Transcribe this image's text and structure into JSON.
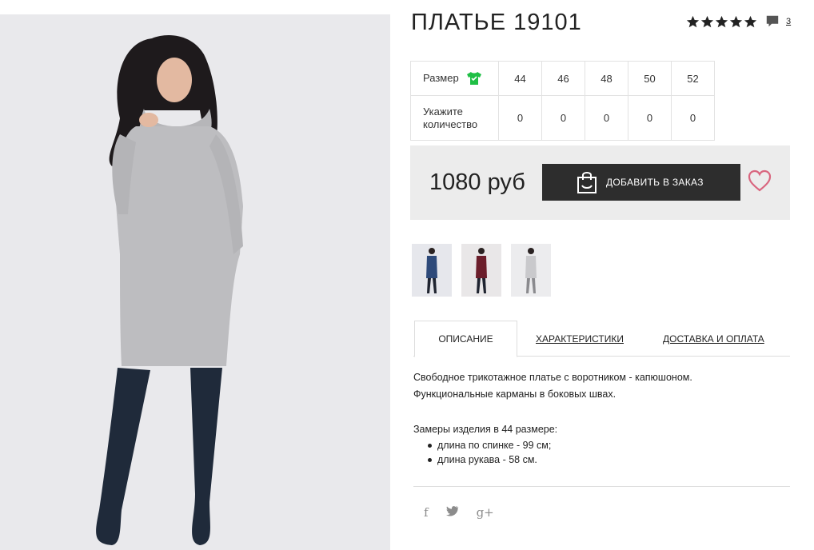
{
  "product": {
    "title": "ПЛАТЬЕ 19101",
    "rating_stars": 5,
    "review_count": "3",
    "price": "1080 руб",
    "add_to_order_label": "ДОБАВИТЬ В ЗАКАЗ"
  },
  "size_table": {
    "size_label": "Размер",
    "qty_label": "Укажите количество",
    "sizes": [
      "44",
      "46",
      "48",
      "50",
      "52"
    ],
    "quantities": [
      "0",
      "0",
      "0",
      "0",
      "0"
    ]
  },
  "thumbnails": [
    {
      "color": "#2e4a7a"
    },
    {
      "color": "#6b1e2b"
    },
    {
      "color": "#c9c9cc"
    }
  ],
  "tabs": [
    {
      "label": "ОПИСАНИЕ",
      "active": true
    },
    {
      "label": "ХАРАКТЕРИСТИКИ",
      "active": false
    },
    {
      "label": "ДОСТАВКА И ОПЛАТА",
      "active": false
    }
  ],
  "description": {
    "line1": "Свободное трикотажное платье с воротником - капюшоном.",
    "line2": "Функциональные карманы в боковых швах.",
    "measurements_title": "Замеры изделия в 44 размере:",
    "items": [
      "длина по спинке - 99 см;",
      "длина рукава - 58 см."
    ]
  },
  "social": {
    "facebook": "f",
    "twitter": "t",
    "google_plus": "g+"
  },
  "colors": {
    "accent_green": "#1fbf45",
    "heart": "#d9667f",
    "button_bg": "#2d2d2d",
    "buybox_bg": "#ececec"
  }
}
